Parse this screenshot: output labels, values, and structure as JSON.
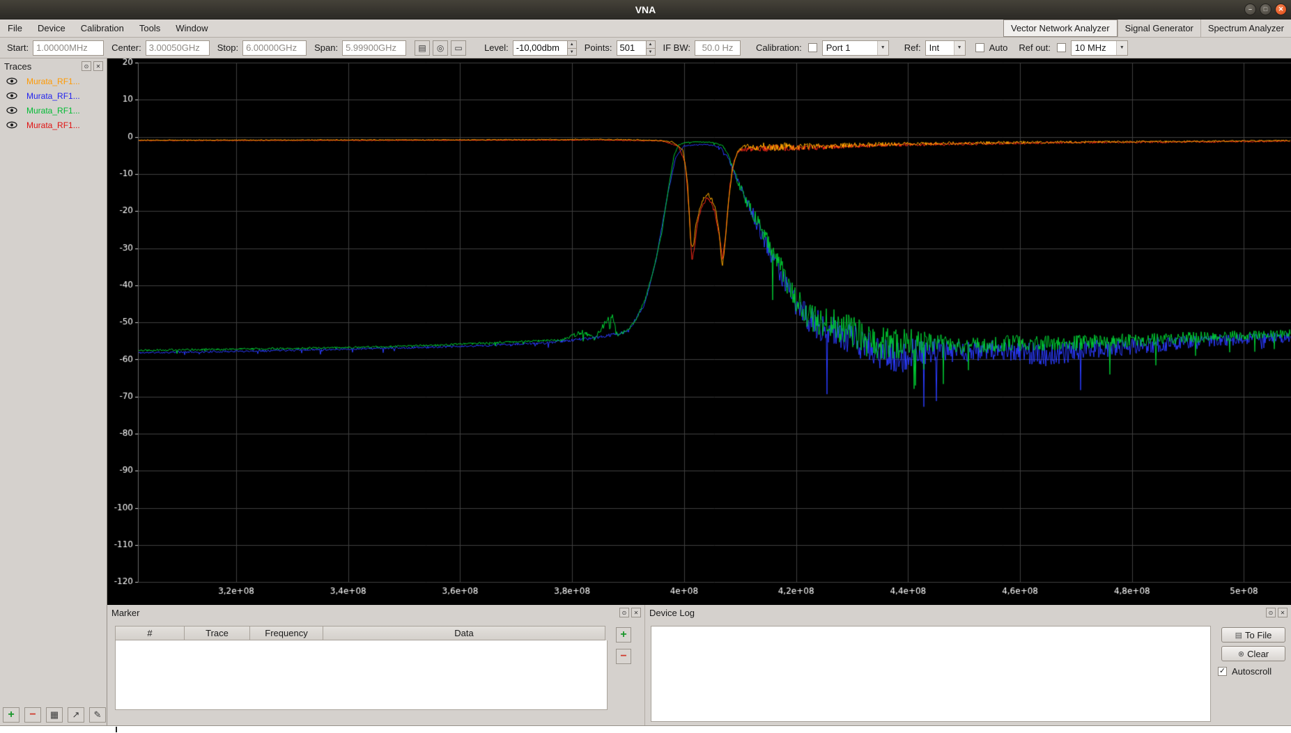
{
  "window": {
    "title": "VNA"
  },
  "menubar": {
    "items": [
      "File",
      "Device",
      "Calibration",
      "Tools",
      "Window"
    ],
    "mode_tabs": [
      {
        "label": "Vector Network Analyzer",
        "active": true
      },
      {
        "label": "Signal Generator",
        "active": false
      },
      {
        "label": "Spectrum Analyzer",
        "active": false
      }
    ]
  },
  "toolbar": {
    "start": {
      "label": "Start:",
      "value": "1.00000MHz"
    },
    "center": {
      "label": "Center:",
      "value": "3.00050GHz"
    },
    "stop": {
      "label": "Stop:",
      "value": "6.00000GHz"
    },
    "span": {
      "label": "Span:",
      "value": "5.99900GHz"
    },
    "level": {
      "label": "Level:",
      "value": "-10,00dbm"
    },
    "points": {
      "label": "Points:",
      "value": "501"
    },
    "ifbw": {
      "label": "IF BW:",
      "value": "50.0 Hz"
    },
    "calibration": {
      "label": "Calibration:",
      "value": "Port 1",
      "checked": false
    },
    "ref": {
      "label": "Ref:",
      "value": "Int"
    },
    "auto": {
      "label": "Auto",
      "checked": false
    },
    "refout": {
      "label": "Ref out:",
      "value": "10 MHz",
      "checked": false
    }
  },
  "traces_panel": {
    "title": "Traces",
    "items": [
      {
        "label": "Murata_RF1...",
        "color": "#ff9900"
      },
      {
        "label": "Murata_RF1...",
        "color": "#2222ee"
      },
      {
        "label": "Murata_RF1...",
        "color": "#00bb33"
      },
      {
        "label": "Murata_RF1...",
        "color": "#e01111"
      }
    ]
  },
  "marker_panel": {
    "title": "Marker",
    "columns": [
      "#",
      "Trace",
      "Frequency",
      "Data"
    ]
  },
  "device_log_panel": {
    "title": "Device Log",
    "to_file_label": "To File",
    "clear_label": "Clear",
    "autoscroll_label": "Autoscroll",
    "autoscroll_checked": true
  },
  "chart_data": {
    "type": "line",
    "title": "",
    "xlabel": "",
    "ylabel": "",
    "background": "#000000",
    "grid": true,
    "legend_position": "traces-panel",
    "x_range": [
      302450000.0,
      508400000.0
    ],
    "y_range": [
      -120,
      20
    ],
    "x_ticks": [
      {
        "value": 320000000.0,
        "label": "3,2e+08"
      },
      {
        "value": 340000000.0,
        "label": "3,4e+08"
      },
      {
        "value": 360000000.0,
        "label": "3,6e+08"
      },
      {
        "value": 380000000.0,
        "label": "3,8e+08"
      },
      {
        "value": 400000000.0,
        "label": "4e+08"
      },
      {
        "value": 420000000.0,
        "label": "4,2e+08"
      },
      {
        "value": 440000000.0,
        "label": "4,4e+08"
      },
      {
        "value": 460000000.0,
        "label": "4,6e+08"
      },
      {
        "value": 480000000.0,
        "label": "4,8e+08"
      },
      {
        "value": 500000000.0,
        "label": "5e+08"
      }
    ],
    "y_ticks": [
      20,
      10,
      0,
      -10,
      -20,
      -30,
      -40,
      -50,
      -60,
      -70,
      -80,
      -90,
      -100,
      -110,
      -120
    ],
    "series": [
      {
        "name": "Murata_RF1...",
        "color": "#2b3cff",
        "seed": 11,
        "spike_prob": 0.01,
        "points": [
          [
            302500000.0,
            -58.2,
            0.5
          ],
          [
            320000000.0,
            -57.8,
            0.5
          ],
          [
            340000000.0,
            -57.2,
            0.5
          ],
          [
            360000000.0,
            -56.5,
            0.5
          ],
          [
            375000000.0,
            -55.6,
            0.6
          ],
          [
            385000000.0,
            -54.0,
            0.8
          ],
          [
            390000000.0,
            -52.5,
            0.8
          ],
          [
            393000000.0,
            -45,
            0.6
          ],
          [
            395000000.0,
            -33,
            0.5
          ],
          [
            397000000.0,
            -16,
            0.4
          ],
          [
            398500000.0,
            -5.5,
            0.3
          ],
          [
            400000000.0,
            -2.4,
            0.25
          ],
          [
            404000000.0,
            -2.0,
            0.25
          ],
          [
            406500000.0,
            -2.8,
            0.4
          ],
          [
            408000000.0,
            -6,
            0.8
          ],
          [
            409500000.0,
            -12,
            2
          ],
          [
            411500000.0,
            -18,
            3
          ],
          [
            414000000.0,
            -27,
            4
          ],
          [
            417000000.0,
            -36,
            5
          ],
          [
            420000000.0,
            -45,
            6
          ],
          [
            423000000.0,
            -50,
            7
          ],
          [
            427000000.0,
            -53,
            8
          ],
          [
            431000000.0,
            -55,
            8
          ],
          [
            435000000.0,
            -58,
            9
          ],
          [
            438000000.0,
            -60,
            9
          ],
          [
            442000000.0,
            -58,
            7
          ],
          [
            446000000.0,
            -57.5,
            6
          ],
          [
            450000000.0,
            -58,
            5
          ],
          [
            455000000.0,
            -57.5,
            5
          ],
          [
            460000000.0,
            -58,
            5
          ],
          [
            465000000.0,
            -59,
            6
          ],
          [
            470000000.0,
            -57.5,
            5
          ],
          [
            480000000.0,
            -56.5,
            4
          ],
          [
            490000000.0,
            -55.5,
            3.5
          ],
          [
            500000000.0,
            -54.5,
            3
          ],
          [
            508400000.0,
            -54,
            2.5
          ]
        ]
      },
      {
        "name": "Murata_RF1...",
        "color": "#00cc33",
        "seed": 22,
        "spike_prob": 0.012,
        "points": [
          [
            302500000.0,
            -57.5,
            0.5
          ],
          [
            320000000.0,
            -57.2,
            0.5
          ],
          [
            340000000.0,
            -56.8,
            0.5
          ],
          [
            355000000.0,
            -56.2,
            0.5
          ],
          [
            370000000.0,
            -55.2,
            0.5
          ],
          [
            378000000.0,
            -54.8,
            0.6
          ],
          [
            382000000.0,
            -52.5,
            1.2
          ],
          [
            384000000.0,
            -54.5,
            0.8
          ],
          [
            386200000.0,
            -49.5,
            1.5
          ],
          [
            387200000.0,
            -48.5,
            1.2
          ],
          [
            388200000.0,
            -53.5,
            0.8
          ],
          [
            390000000.0,
            -52.0,
            0.8
          ],
          [
            391500000.0,
            -49,
            0.6
          ],
          [
            393000000.0,
            -44,
            0.6
          ],
          [
            394500000.0,
            -36,
            0.5
          ],
          [
            396000000.0,
            -26,
            0.4
          ],
          [
            397200000.0,
            -14,
            0.3
          ],
          [
            398200000.0,
            -5,
            0.25
          ],
          [
            399000000.0,
            -2.2,
            0.2
          ],
          [
            400000000.0,
            -1.6,
            0.2
          ],
          [
            402000000.0,
            -1.3,
            0.2
          ],
          [
            405000000.0,
            -1.5,
            0.2
          ],
          [
            406800000.0,
            -2.2,
            0.3
          ],
          [
            407800000.0,
            -4.5,
            0.5
          ],
          [
            408800000.0,
            -9,
            1.2
          ],
          [
            409800000.0,
            -13,
            2
          ],
          [
            411000000.0,
            -17,
            3
          ],
          [
            412500000.0,
            -21,
            3.5
          ],
          [
            414000000.0,
            -26,
            4
          ],
          [
            415500000.0,
            -30,
            5
          ],
          [
            417000000.0,
            -34,
            5
          ],
          [
            418500000.0,
            -40,
            6
          ],
          [
            420000000.0,
            -44,
            6
          ],
          [
            421500000.0,
            -47,
            7
          ],
          [
            423000000.0,
            -49,
            7
          ],
          [
            425000000.0,
            -50,
            8
          ],
          [
            427000000.0,
            -51,
            8
          ],
          [
            429000000.0,
            -52,
            8
          ],
          [
            431000000.0,
            -53,
            8
          ],
          [
            433000000.0,
            -55,
            9
          ],
          [
            435000000.0,
            -56,
            9
          ],
          [
            437000000.0,
            -56,
            8
          ],
          [
            439000000.0,
            -55.5,
            7
          ],
          [
            441000000.0,
            -55,
            6
          ],
          [
            444000000.0,
            -55.5,
            5
          ],
          [
            447000000.0,
            -56,
            4.5
          ],
          [
            450000000.0,
            -56.5,
            4
          ],
          [
            455000000.0,
            -56,
            4
          ],
          [
            460000000.0,
            -55.5,
            4
          ],
          [
            465000000.0,
            -55.8,
            4
          ],
          [
            470000000.0,
            -55.5,
            4
          ],
          [
            475000000.0,
            -55.2,
            3.5
          ],
          [
            480000000.0,
            -54.8,
            3.5
          ],
          [
            485000000.0,
            -54.5,
            3
          ],
          [
            490000000.0,
            -54.2,
            3
          ],
          [
            495000000.0,
            -53.8,
            2.5
          ],
          [
            500000000.0,
            -53.5,
            2.5
          ],
          [
            504000000.0,
            -53.2,
            2
          ],
          [
            508400000.0,
            -53,
            2
          ]
        ]
      },
      {
        "name": "Murata_RF1...",
        "color": "#ff2a1a",
        "seed": 33,
        "spike_prob": 0,
        "points": [
          [
            302500000.0,
            -1.0,
            0.15
          ],
          [
            350000000.0,
            -0.95,
            0.15
          ],
          [
            385000000.0,
            -0.85,
            0.2
          ],
          [
            396000000.0,
            -1.1,
            0.25
          ],
          [
            399000000.0,
            -2.5,
            0.3
          ],
          [
            400200000.0,
            -7,
            0.4
          ],
          [
            400900000.0,
            -20,
            0.6
          ],
          [
            401400000.0,
            -34,
            1
          ],
          [
            401800000.0,
            -30,
            0.8
          ],
          [
            402400000.0,
            -23,
            0.8
          ],
          [
            403200000.0,
            -18.5,
            0.9
          ],
          [
            404000000.0,
            -16.5,
            1
          ],
          [
            404800000.0,
            -17.5,
            1
          ],
          [
            405600000.0,
            -21,
            0.9
          ],
          [
            406300000.0,
            -27,
            0.8
          ],
          [
            406900000.0,
            -33,
            0.8
          ],
          [
            407500000.0,
            -25,
            0.8
          ],
          [
            408200000.0,
            -13,
            0.7
          ],
          [
            409000000.0,
            -6,
            0.6
          ],
          [
            410000000.0,
            -3.5,
            0.8
          ],
          [
            412000000.0,
            -3.2,
            1.4
          ],
          [
            415000000.0,
            -3.0,
            1.6
          ],
          [
            420000000.0,
            -3.0,
            1.4
          ],
          [
            425000000.0,
            -2.8,
            1.2
          ],
          [
            430000000.0,
            -2.5,
            1.0
          ],
          [
            440000000.0,
            -2.1,
            0.8
          ],
          [
            450000000.0,
            -1.9,
            0.7
          ],
          [
            460000000.0,
            -1.7,
            0.6
          ],
          [
            470000000.0,
            -1.5,
            0.5
          ],
          [
            485000000.0,
            -1.4,
            0.45
          ],
          [
            500000000.0,
            -1.25,
            0.4
          ],
          [
            508400000.0,
            -1.15,
            0.4
          ]
        ]
      },
      {
        "name": "Murata_RF1...",
        "color": "#ffa800",
        "seed": 44,
        "spike_prob": 0,
        "points": [
          [
            302500000.0,
            -0.9,
            0.2
          ],
          [
            330000000.0,
            -0.85,
            0.2
          ],
          [
            360000000.0,
            -0.8,
            0.2
          ],
          [
            385000000.0,
            -0.7,
            0.25
          ],
          [
            395000000.0,
            -0.9,
            0.3
          ],
          [
            398000000.0,
            -1.4,
            0.3
          ],
          [
            399800000.0,
            -3.5,
            0.3
          ],
          [
            400600000.0,
            -12,
            0.5
          ],
          [
            401200000.0,
            -29,
            0.8
          ],
          [
            401600000.0,
            -30,
            0.8
          ],
          [
            402100000.0,
            -24,
            0.8
          ],
          [
            402800000.0,
            -19.5,
            0.8
          ],
          [
            403500000.0,
            -16.5,
            1
          ],
          [
            404300000.0,
            -15.5,
            1
          ],
          [
            405000000.0,
            -17,
            1
          ],
          [
            405700000.0,
            -20,
            0.8
          ],
          [
            406300000.0,
            -26,
            0.8
          ],
          [
            406800000.0,
            -35.5,
            0.8
          ],
          [
            407300000.0,
            -29,
            0.8
          ],
          [
            407900000.0,
            -18,
            0.8
          ],
          [
            408600000.0,
            -9,
            0.8
          ],
          [
            409400000.0,
            -4.5,
            0.8
          ],
          [
            410500000.0,
            -2.5,
            1.2
          ],
          [
            412000000.0,
            -3,
            1.8
          ],
          [
            414000000.0,
            -2.5,
            2
          ],
          [
            416000000.0,
            -3,
            1.8
          ],
          [
            418000000.0,
            -2.5,
            1.8
          ],
          [
            420000000.0,
            -2.8,
            1.6
          ],
          [
            423000000.0,
            -2.4,
            1.4
          ],
          [
            426000000.0,
            -2.6,
            1.3
          ],
          [
            430000000.0,
            -2.2,
            1.2
          ],
          [
            435000000.0,
            -2.0,
            1.0
          ],
          [
            440000000.0,
            -1.9,
            0.9
          ],
          [
            450000000.0,
            -1.7,
            0.8
          ],
          [
            460000000.0,
            -1.5,
            0.7
          ],
          [
            470000000.0,
            -1.4,
            0.6
          ],
          [
            480000000.0,
            -1.3,
            0.5
          ],
          [
            490000000.0,
            -1.2,
            0.45
          ],
          [
            500000000.0,
            -1.1,
            0.4
          ],
          [
            508400000.0,
            -1.0,
            0.4
          ]
        ]
      }
    ]
  }
}
